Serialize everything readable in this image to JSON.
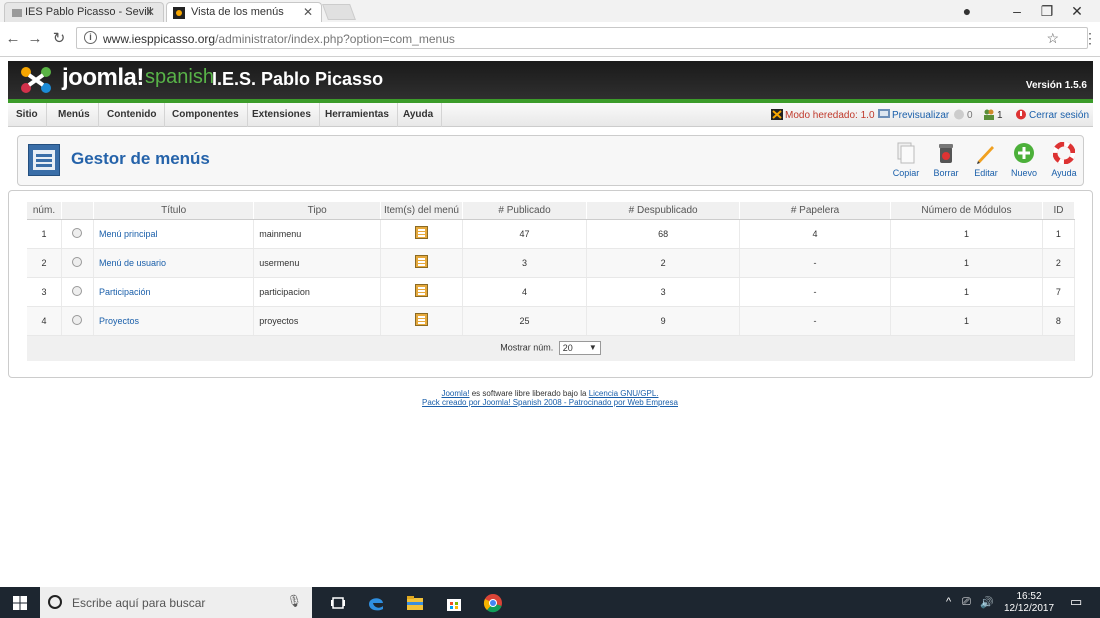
{
  "browser": {
    "tabs": [
      {
        "label": "IES Pablo Picasso - Sevill",
        "active": false
      },
      {
        "label": "Vista de los menús",
        "active": true
      }
    ],
    "url_host": "www.iesppicasso.org",
    "url_path": "/administrator/index.php?option=com_menus"
  },
  "header": {
    "brand": "joomla!",
    "brand_suffix": "spanish",
    "site_name": "I.E.S. Pablo Picasso",
    "version": "Versión 1.5.6"
  },
  "menu": {
    "items": [
      "Sitio",
      "Menús",
      "Contenido",
      "Componentes",
      "Extensiones",
      "Herramientas",
      "Ayuda"
    ],
    "status": {
      "mode": "Modo heredado: 1.0",
      "preview": "Previsualizar",
      "messages": "0",
      "users": "1",
      "logout": "Cerrar sesión"
    }
  },
  "toolbar": {
    "title": "Gestor de menús",
    "buttons": [
      "Copiar",
      "Borrar",
      "Editar",
      "Nuevo",
      "Ayuda"
    ]
  },
  "table": {
    "headers": [
      "núm.",
      "",
      "Título",
      "Tipo",
      "Item(s) del menú",
      "# Publicado",
      "# Despublicado",
      "# Papelera",
      "Número de Módulos",
      "ID"
    ],
    "rows": [
      {
        "num": "1",
        "title": "Menú principal",
        "type": "mainmenu",
        "published": "47",
        "unpublished": "68",
        "trash": "4",
        "modules": "1",
        "id": "1"
      },
      {
        "num": "2",
        "title": "Menú de usuario",
        "type": "usermenu",
        "published": "3",
        "unpublished": "2",
        "trash": "-",
        "modules": "1",
        "id": "2"
      },
      {
        "num": "3",
        "title": "Participación",
        "type": "participacion",
        "published": "4",
        "unpublished": "3",
        "trash": "-",
        "modules": "1",
        "id": "7"
      },
      {
        "num": "4",
        "title": "Proyectos",
        "type": "proyectos",
        "published": "25",
        "unpublished": "9",
        "trash": "-",
        "modules": "1",
        "id": "8"
      }
    ],
    "limit_label": "Mostrar núm.",
    "limit_value": "20"
  },
  "footer": {
    "line1_link": "Joomla!",
    "line1_text": " es software libre liberado bajo la ",
    "line1_license": "Licencia GNU/GPL.",
    "line2": "Pack creado por Joomla! Spanish 2008 - Patrocinado por Web Empresa"
  },
  "taskbar": {
    "search_placeholder": "Escribe aquí para buscar",
    "time": "16:52",
    "date": "12/12/2017"
  },
  "colors": {
    "joomla_green": "#3c9c2a",
    "link_blue": "#1a5faa",
    "title_blue": "#2563aa"
  }
}
